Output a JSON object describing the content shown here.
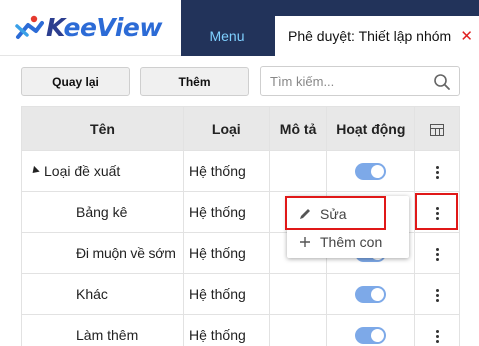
{
  "header": {
    "logo_k": "K",
    "logo_rest": "eeView",
    "menu_label": "Menu",
    "active_tab_label": "Phê duyệt: Thiết lập nhóm",
    "close_symbol": "✕"
  },
  "toolbar": {
    "back_label": "Quay lại",
    "add_label": "Thêm",
    "search_placeholder": "Tìm kiếm..."
  },
  "table": {
    "columns": [
      "Tên",
      "Loại",
      "Mô tả",
      "Hoạt động",
      "grid-icon"
    ],
    "rows": [
      {
        "name": "Loại đề xuất",
        "type": "Hệ thống",
        "desc": "",
        "active": true,
        "level": 0,
        "expanded": true
      },
      {
        "name": "Bảng kê",
        "type": "Hệ thống",
        "desc": "",
        "active": true,
        "level": 1
      },
      {
        "name": "Đi muộn về sớm",
        "type": "Hệ thống",
        "desc": "",
        "active": true,
        "level": 1
      },
      {
        "name": "Khác",
        "type": "Hệ thống",
        "desc": "",
        "active": true,
        "level": 1
      },
      {
        "name": "Làm thêm",
        "type": "Hệ thống",
        "desc": "",
        "active": true,
        "level": 1
      }
    ]
  },
  "context_menu": {
    "edit_label": "Sửa",
    "add_child_label": "Thêm con",
    "edit_icon": "pencil-icon",
    "add_icon": "plus-icon"
  },
  "colors": {
    "header_dark": "#22335a",
    "menu_text": "#7fd0ff",
    "toggle_on": "#7da9e8",
    "highlight": "#e01818"
  }
}
